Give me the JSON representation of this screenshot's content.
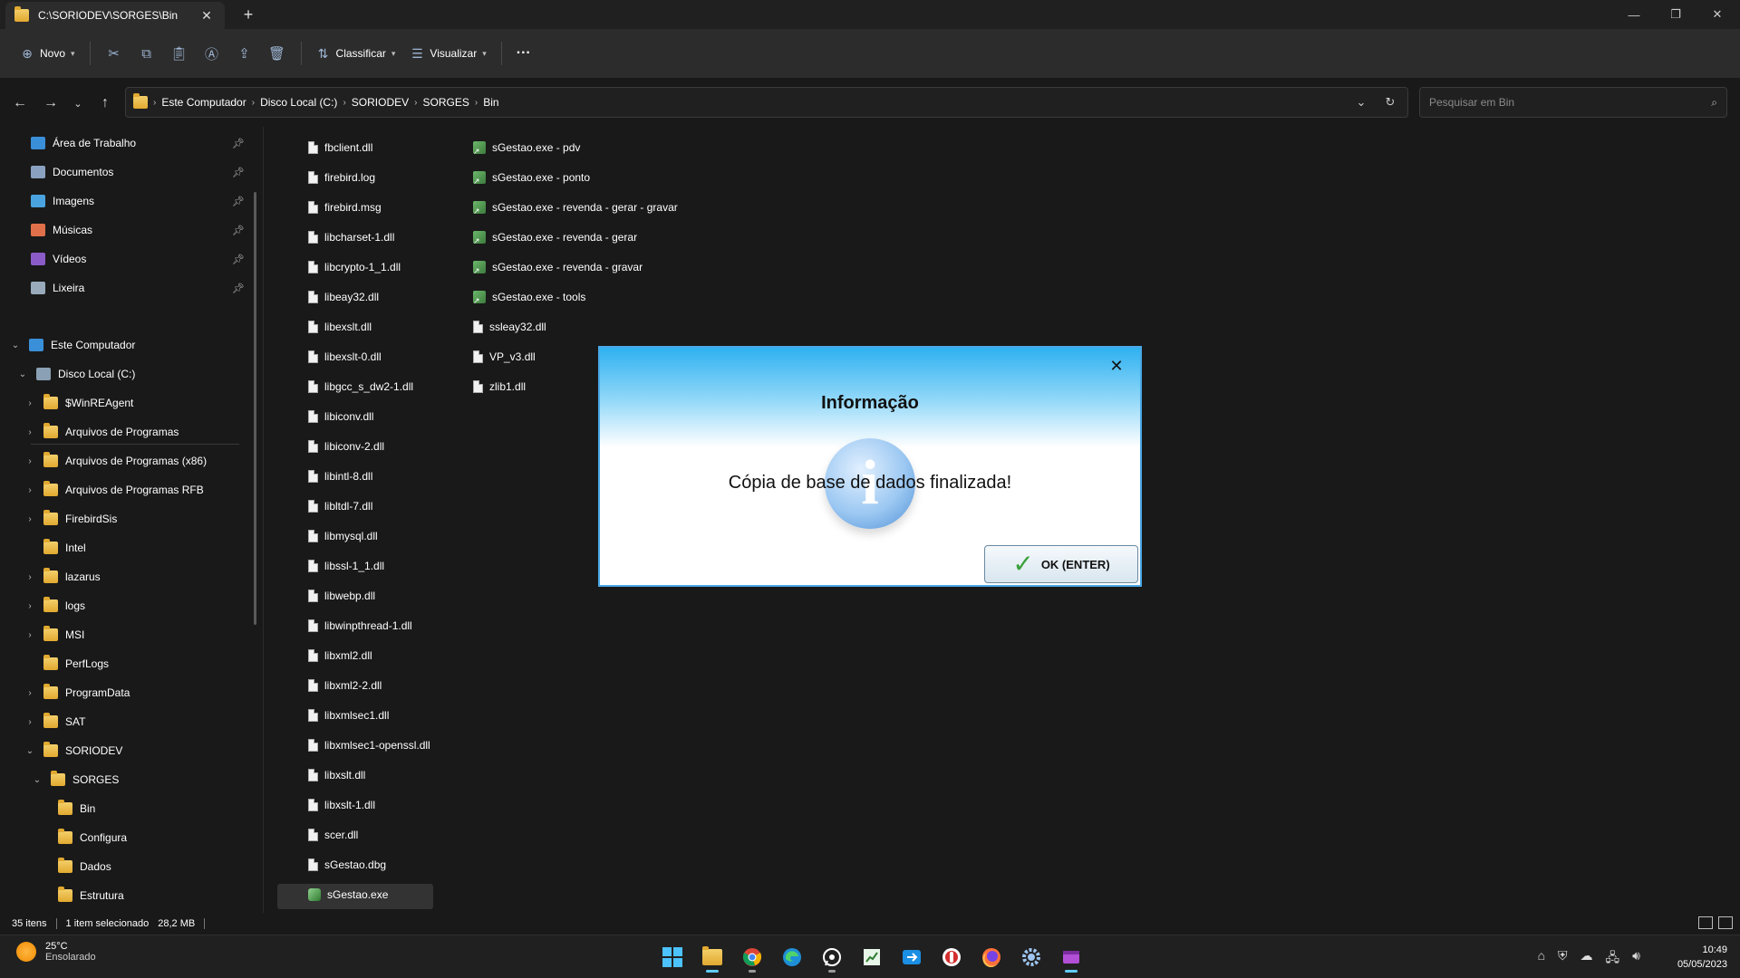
{
  "window": {
    "tab_title": "C:\\SORIODEV\\SORGES\\Bin",
    "tab_close_glyph": "✕",
    "new_tab_glyph": "+"
  },
  "command_bar": {
    "new_label": "Novo",
    "sort_label": "Classificar",
    "view_label": "Visualizar",
    "more_glyph": "···"
  },
  "address": {
    "breadcrumbs": [
      "Este Computador",
      "Disco Local (C:)",
      "SORIODEV",
      "SORGES",
      "Bin"
    ],
    "search_placeholder": "Pesquisar em Bin"
  },
  "sidebar": {
    "quick_access": [
      {
        "label": "Área de Trabalho",
        "icon": "desktop-icon",
        "color": "#3a8fd9"
      },
      {
        "label": "Documentos",
        "icon": "documents-icon",
        "color": "#8aa2bf"
      },
      {
        "label": "Imagens",
        "icon": "pictures-icon",
        "color": "#4aa3df"
      },
      {
        "label": "Músicas",
        "icon": "music-icon",
        "color": "#e0704a"
      },
      {
        "label": "Vídeos",
        "icon": "videos-icon",
        "color": "#8b5cc8"
      },
      {
        "label": "Lixeira",
        "icon": "recycle-bin-icon",
        "color": "#9ab"
      }
    ],
    "tree": [
      {
        "label": "Este Computador",
        "level": 0,
        "expanded": true,
        "icon": "computer-icon"
      },
      {
        "label": "Disco Local (C:)",
        "level": 1,
        "expanded": true,
        "icon": "drive-icon"
      },
      {
        "label": "$WinREAgent",
        "level": 2,
        "expanded": false,
        "icon": "folder-icon"
      },
      {
        "label": "Arquivos de Programas",
        "level": 2,
        "expanded": false,
        "icon": "folder-icon"
      },
      {
        "label": "Arquivos de Programas (x86)",
        "level": 2,
        "expanded": false,
        "icon": "folder-icon"
      },
      {
        "label": "Arquivos de Programas RFB",
        "level": 2,
        "expanded": false,
        "icon": "folder-icon"
      },
      {
        "label": "FirebirdSis",
        "level": 2,
        "expanded": false,
        "icon": "folder-icon"
      },
      {
        "label": "Intel",
        "level": 2,
        "expanded": null,
        "icon": "folder-icon"
      },
      {
        "label": "lazarus",
        "level": 2,
        "expanded": false,
        "icon": "folder-icon"
      },
      {
        "label": "logs",
        "level": 2,
        "expanded": false,
        "icon": "folder-icon"
      },
      {
        "label": "MSI",
        "level": 2,
        "expanded": false,
        "icon": "folder-icon"
      },
      {
        "label": "PerfLogs",
        "level": 2,
        "expanded": null,
        "icon": "folder-icon"
      },
      {
        "label": "ProgramData",
        "level": 2,
        "expanded": false,
        "icon": "folder-icon"
      },
      {
        "label": "SAT",
        "level": 2,
        "expanded": false,
        "icon": "folder-icon"
      },
      {
        "label": "SORIODEV",
        "level": 2,
        "expanded": true,
        "icon": "folder-icon"
      },
      {
        "label": "SORGES",
        "level": 3,
        "expanded": true,
        "icon": "folder-icon"
      },
      {
        "label": "Bin",
        "level": 4,
        "expanded": null,
        "icon": "folder-icon",
        "selected": true
      },
      {
        "label": "Configura",
        "level": 4,
        "expanded": null,
        "icon": "folder-icon"
      },
      {
        "label": "Dados",
        "level": 4,
        "expanded": null,
        "icon": "folder-icon"
      },
      {
        "label": "Estrutura",
        "level": 4,
        "expanded": null,
        "icon": "folder-icon"
      }
    ]
  },
  "files": {
    "column1": [
      "fbclient.dll",
      "firebird.log",
      "firebird.msg",
      "libcharset-1.dll",
      "libcrypto-1_1.dll",
      "libeay32.dll",
      "libexslt.dll",
      "libexslt-0.dll",
      "libgcc_s_dw2-1.dll",
      "libiconv.dll",
      "libiconv-2.dll",
      "libintl-8.dll",
      "libltdl-7.dll",
      "libmysql.dll",
      "libssl-1_1.dll",
      "libwebp.dll",
      "libwinpthread-1.dll",
      "libxml2.dll",
      "libxml2-2.dll",
      "libxmlsec1.dll",
      "libxmlsec1-openssl.dll",
      "libxslt.dll",
      "libxslt-1.dll",
      "scer.dll",
      "sGestao.dbg",
      "sGestao.exe"
    ],
    "column2": [
      {
        "name": "sGestao.exe - pdv",
        "type": "shortcut"
      },
      {
        "name": "sGestao.exe - ponto",
        "type": "shortcut"
      },
      {
        "name": "sGestao.exe - revenda - gerar - gravar",
        "type": "shortcut"
      },
      {
        "name": "sGestao.exe - revenda - gerar",
        "type": "shortcut"
      },
      {
        "name": "sGestao.exe - revenda - gravar",
        "type": "shortcut"
      },
      {
        "name": "sGestao.exe - tools",
        "type": "shortcut"
      },
      {
        "name": "ssleay32.dll",
        "type": "file"
      },
      {
        "name": "VP_v3.dll",
        "type": "file"
      },
      {
        "name": "zlib1.dll",
        "type": "file"
      }
    ],
    "selected": "sGestao.exe"
  },
  "status": {
    "count": "35 itens",
    "selection": "1 item selecionado",
    "size": "28,2 MB"
  },
  "dialog": {
    "title": "Informação",
    "message": "Cópia de base de dados finalizada!",
    "ok_label": "OK (ENTER)",
    "close_glyph": "✕",
    "info_glyph": "i",
    "accent": "#2fb1f0"
  },
  "taskbar": {
    "temperature": "25°C",
    "condition": "Ensolarado",
    "time": "10:49",
    "date": "05/05/2023"
  }
}
